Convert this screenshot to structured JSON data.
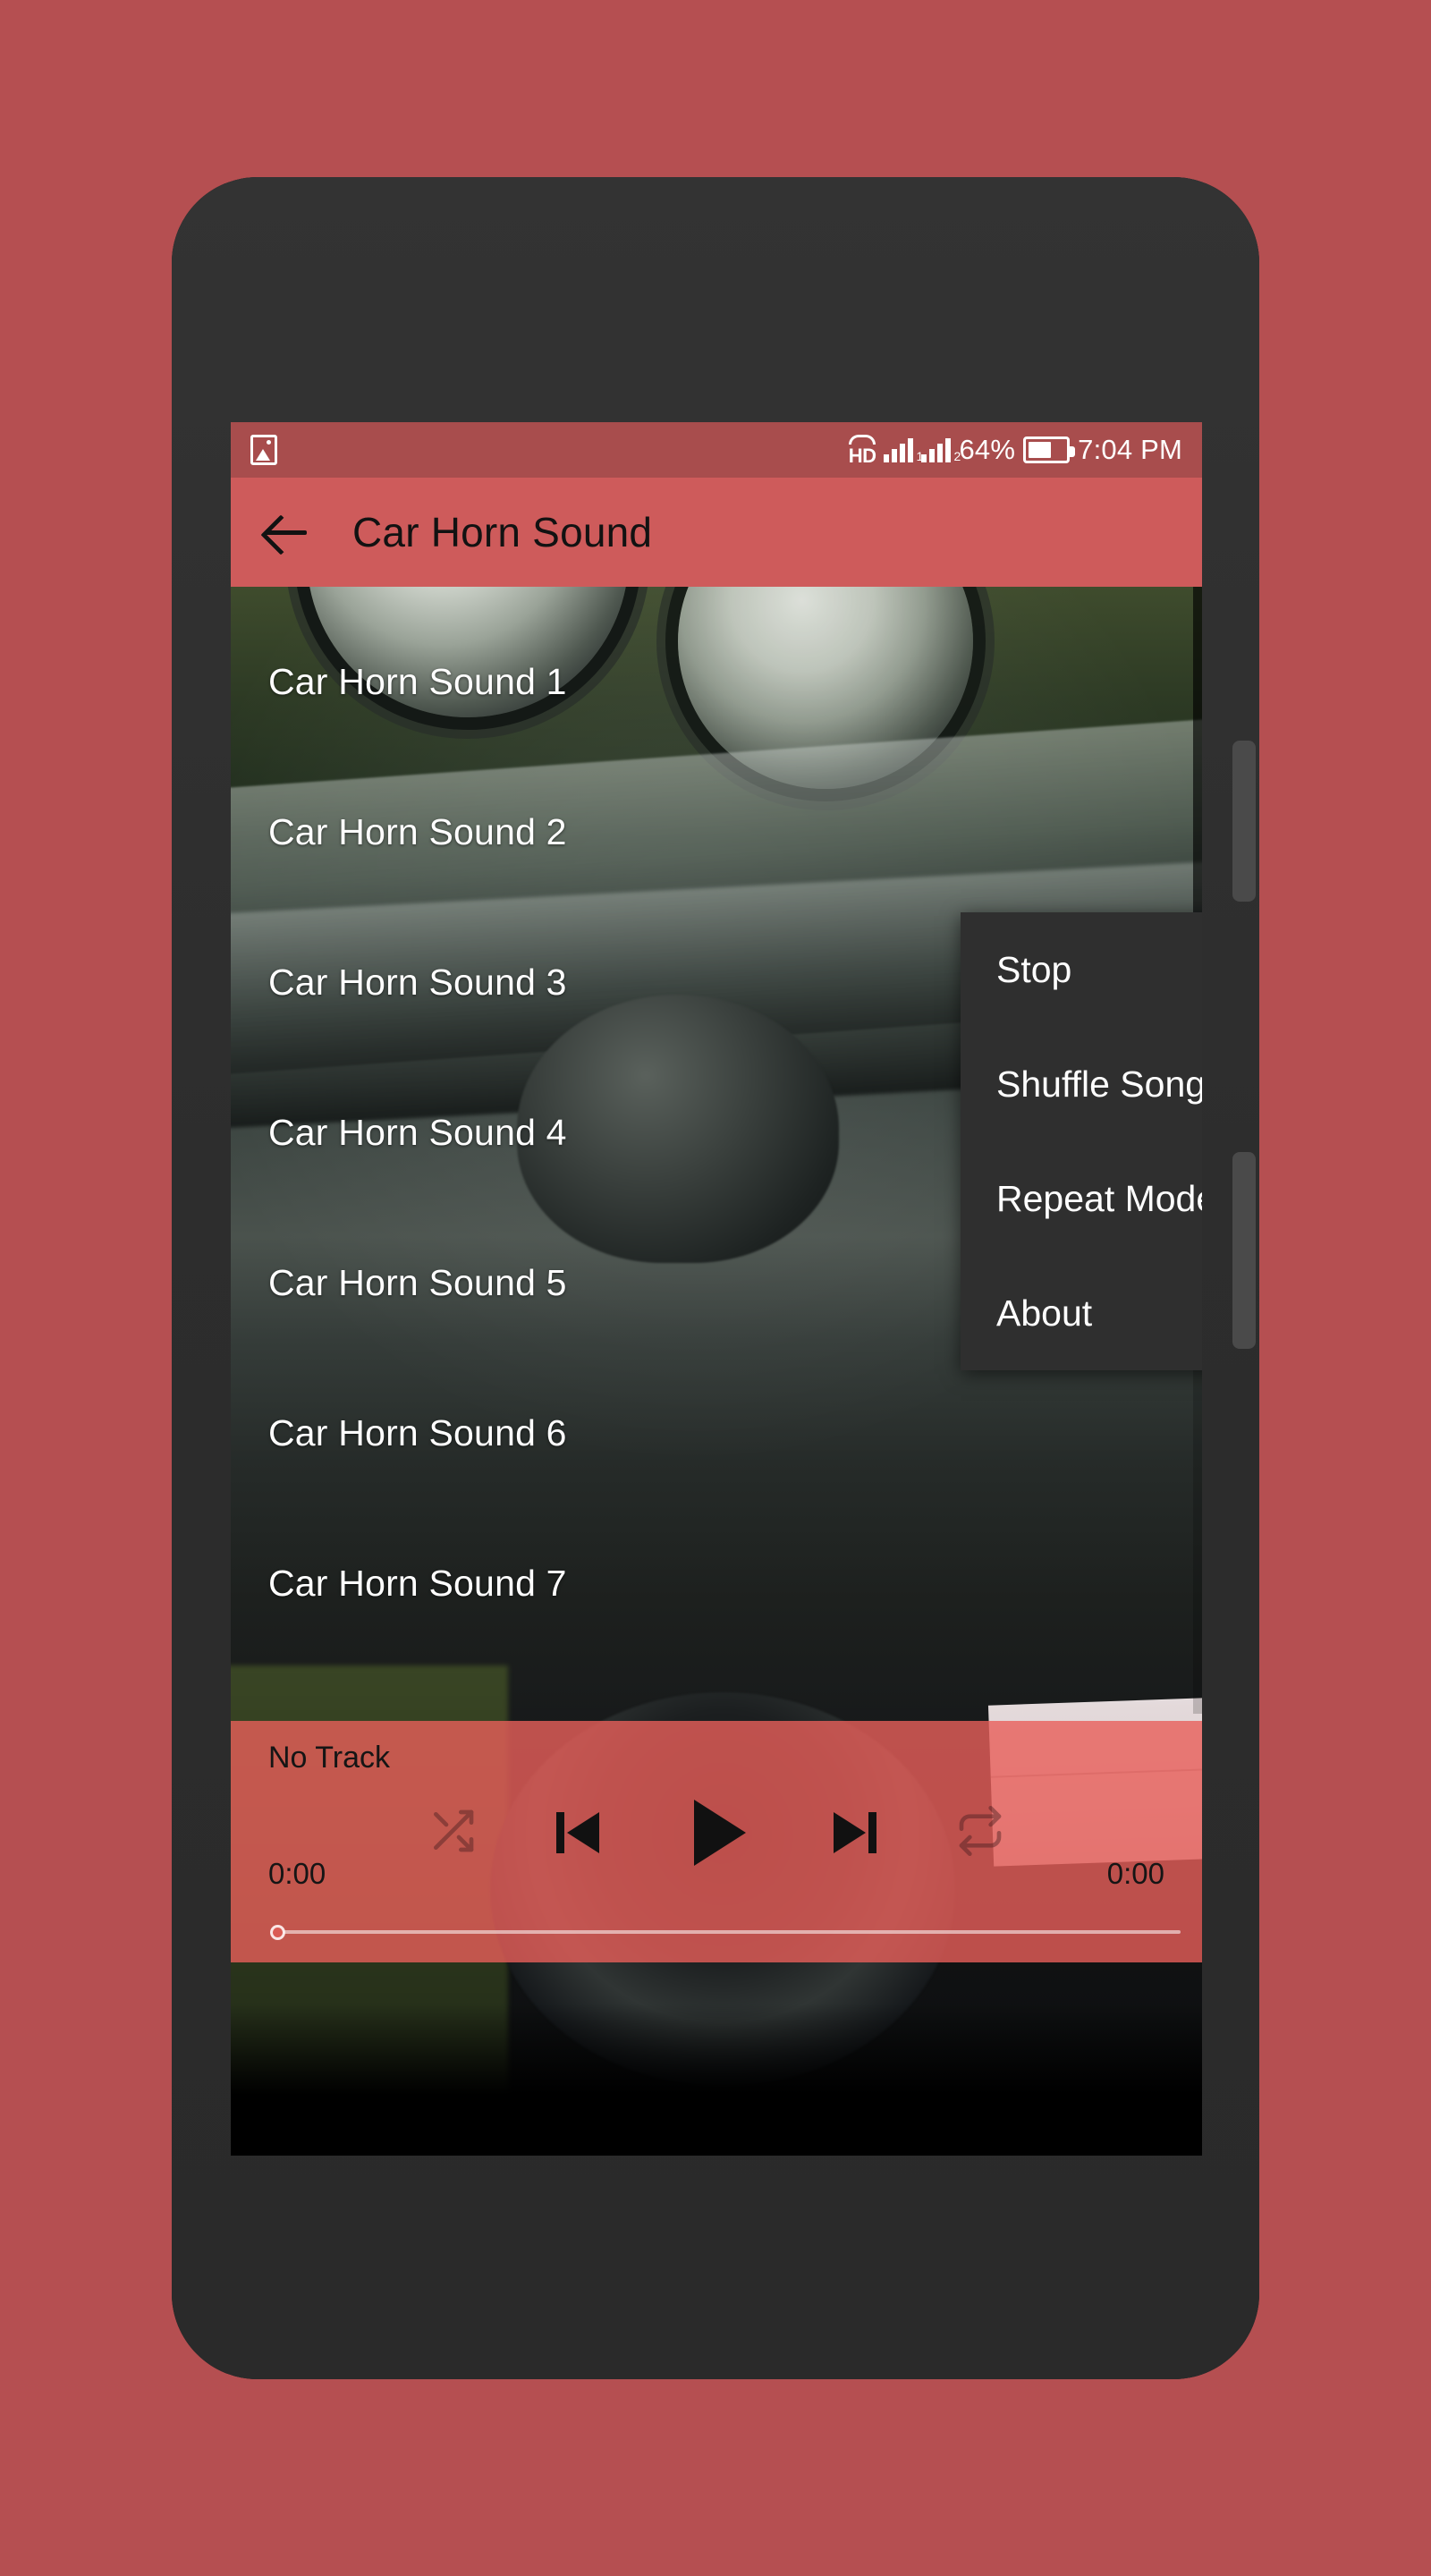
{
  "page": {
    "background_color": "#b54f51"
  },
  "device": {
    "body_color": "#2e2e2e",
    "camera_icon": "camera-icon",
    "earpiece_icon": "earpiece-speaker",
    "sensor_icon": "proximity-sensor",
    "volume_button": "volume-rocker",
    "power_button": "power-button"
  },
  "status_bar": {
    "background_color": "#a84d4d",
    "left_icon": "image-icon",
    "network_label": "HD",
    "signal_1_label": "1",
    "signal_2_label": "2",
    "battery_percent": "64%",
    "battery_level": 64,
    "time": "7:04 PM"
  },
  "toolbar": {
    "background_color": "#ce5b5b",
    "back_icon": "back-arrow-icon",
    "title": "Car Horn Sound"
  },
  "list": {
    "items": [
      {
        "label": "Car Horn Sound 1"
      },
      {
        "label": "Car Horn Sound 2"
      },
      {
        "label": "Car Horn Sound 3"
      },
      {
        "label": "Car Horn Sound 4"
      },
      {
        "label": "Car Horn Sound 5"
      },
      {
        "label": "Car Horn Sound 6"
      },
      {
        "label": "Car Horn Sound 7"
      }
    ]
  },
  "player": {
    "background_color": "#e95f5a",
    "track_title": "No Track",
    "shuffle_icon": "shuffle-icon",
    "previous_icon": "skip-previous-icon",
    "play_icon": "play-icon",
    "next_icon": "skip-next-icon",
    "repeat_icon": "repeat-icon",
    "elapsed_time": "0:00",
    "total_time": "0:00",
    "progress_percent": 0
  },
  "menu": {
    "background_color": "#2f2f2f",
    "items": [
      {
        "label": "Stop",
        "has_submenu": false
      },
      {
        "label": "Shuffle Songs",
        "has_submenu": true
      },
      {
        "label": "Repeat Mode",
        "has_submenu": true
      },
      {
        "label": "About",
        "has_submenu": false
      }
    ]
  }
}
